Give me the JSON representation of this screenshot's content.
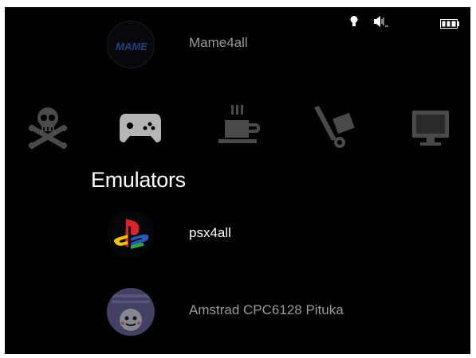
{
  "status": {
    "icons": [
      "lightbulb-icon",
      "volume-icon",
      "battery-icon"
    ]
  },
  "section": {
    "title": "Emulators",
    "icons": [
      "skull-crossbones-icon",
      "gamepad-icon",
      "coffee-cup-icon",
      "hand-truck-icon",
      "monitor-icon"
    ],
    "active_index": 1
  },
  "items": [
    {
      "label": "Mame4all",
      "logo_text": "MAME",
      "state": "dimmed"
    },
    {
      "label": "psx4all",
      "state": "selected"
    },
    {
      "label": "Amstrad CPC6128 Pituka",
      "state": "dimmed"
    }
  ],
  "colors": {
    "background": "#000000",
    "text_selected": "#ffffff",
    "text_dimmed": "#9a9a9a",
    "icon_inactive": "#4a4a4a",
    "icon_active": "#b5b5b5"
  }
}
